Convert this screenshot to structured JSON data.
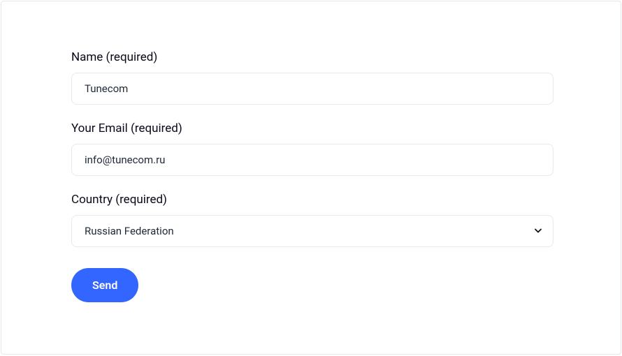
{
  "form": {
    "name": {
      "label": "Name (required)",
      "value": "Tunecom"
    },
    "email": {
      "label": "Your Email (required)",
      "value": "info@tunecom.ru"
    },
    "country": {
      "label": "Country (required)",
      "selected": "Russian Federation"
    },
    "submit": {
      "label": "Send"
    }
  }
}
